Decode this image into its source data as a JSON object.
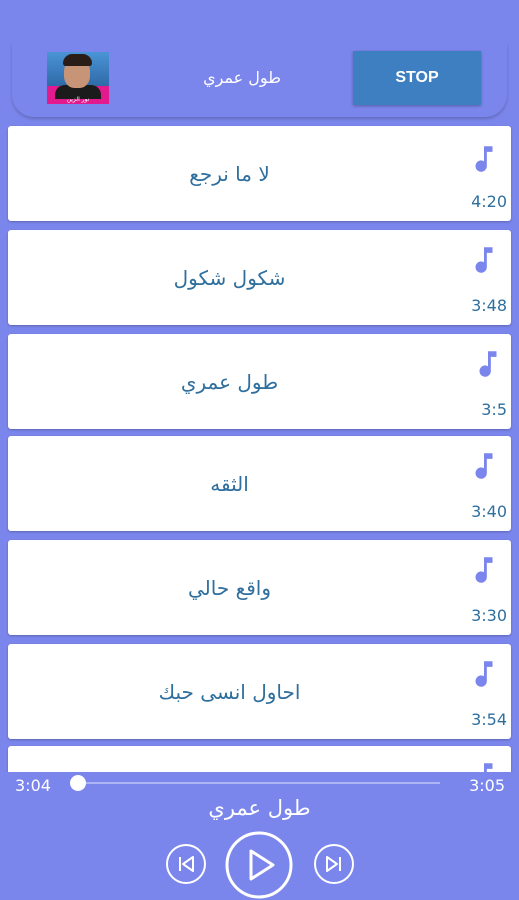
{
  "now_playing": {
    "title": "طول عمري",
    "stop_label": "STOP",
    "thumbnail_caption": "نور الزين"
  },
  "songs": [
    {
      "title": "لا ما نرجع",
      "duration": "4:20"
    },
    {
      "title": "شكول شكول",
      "duration": "3:48"
    },
    {
      "title": "طول عمري",
      "duration": "3:5"
    },
    {
      "title": "الثقه",
      "duration": "3:40"
    },
    {
      "title": "واقع حالي",
      "duration": "3:30"
    },
    {
      "title": "احاول انسى حبك",
      "duration": "3:54"
    }
  ],
  "player": {
    "elapsed": "3:04",
    "total": "3:05",
    "title": "طول عمري",
    "progress": 0.0
  },
  "icons": {
    "list_item": "music-note-icon",
    "prev": "skip-previous-icon",
    "play": "play-icon",
    "next": "skip-next-icon"
  },
  "colors": {
    "background": "#7b86ec",
    "accent": "#7b86ec",
    "text": "#2f6f9e",
    "stop_button": "#3d7fc0"
  }
}
